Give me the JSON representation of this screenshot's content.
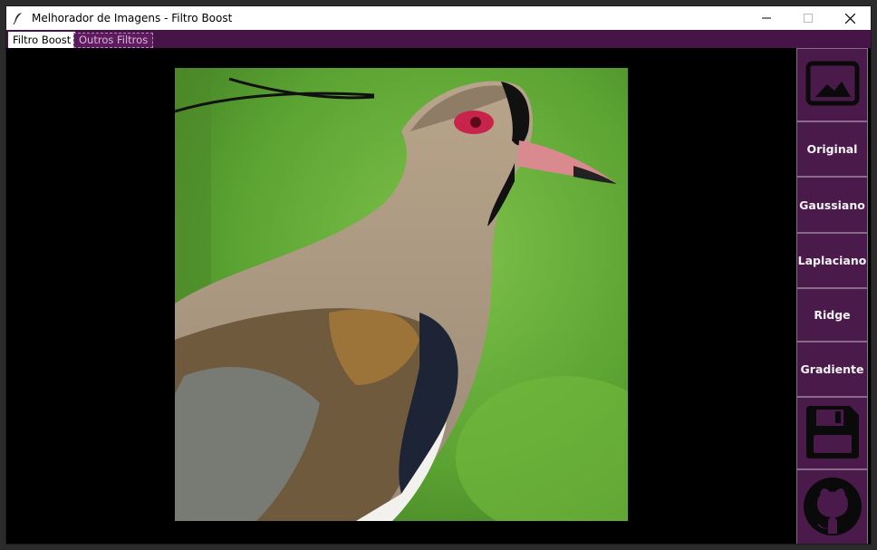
{
  "window": {
    "title": "Melhorador de Imagens - Filtro Boost"
  },
  "tabs": [
    {
      "label": "Filtro Boost",
      "active": true
    },
    {
      "label": "Outros Filtros",
      "active": false
    }
  ],
  "sidebar": {
    "buttons": [
      {
        "kind": "icon",
        "icon": "image-icon"
      },
      {
        "kind": "text",
        "label": "Original"
      },
      {
        "kind": "text",
        "label": "Gaussiano"
      },
      {
        "kind": "text",
        "label": "Laplaciano"
      },
      {
        "kind": "text",
        "label": "Ridge"
      },
      {
        "kind": "text",
        "label": "Gradiente"
      },
      {
        "kind": "icon",
        "icon": "save-icon"
      },
      {
        "kind": "icon",
        "icon": "github-icon"
      }
    ]
  },
  "colors": {
    "accent": "#4a1a4a",
    "tabbar": "#471447",
    "background": "#000000"
  }
}
